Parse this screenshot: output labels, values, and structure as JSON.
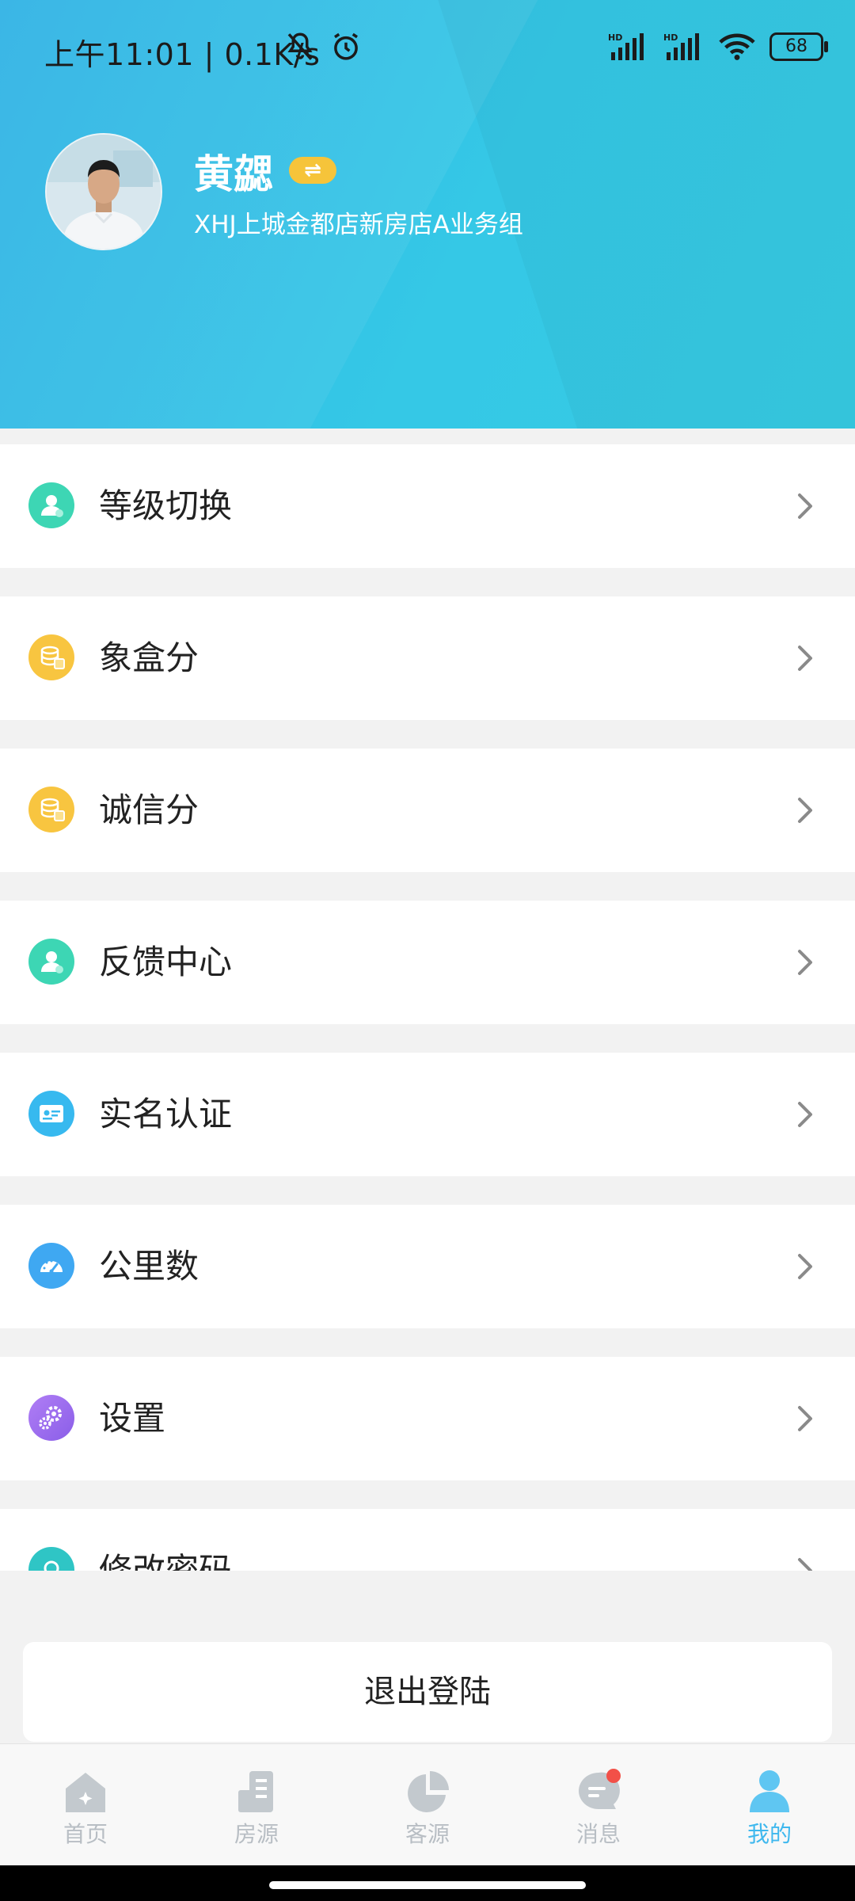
{
  "status_bar": {
    "time_speed": "上午11:01 | 0.1K/s",
    "battery": "68"
  },
  "profile": {
    "name": "黄勰",
    "switch_icon": "⇌",
    "org": "XHJ上城金都店新房店A业务组"
  },
  "menu": [
    {
      "label": "等级切换",
      "icon": "user-badge-icon",
      "color": "#3dd6b4"
    },
    {
      "label": "象盒分",
      "icon": "coins-icon",
      "color": "#f8c540"
    },
    {
      "label": "诚信分",
      "icon": "coins-icon",
      "color": "#f8c540"
    },
    {
      "label": "反馈中心",
      "icon": "user-badge-icon",
      "color": "#3dd6b4"
    },
    {
      "label": "实名认证",
      "icon": "id-card-icon",
      "color": "#37b9ef"
    },
    {
      "label": "公里数",
      "icon": "speedometer-icon",
      "color": "#3fa8f2"
    },
    {
      "label": "设置",
      "icon": "gear-icon",
      "color": "#9a6ff0"
    },
    {
      "label": "修改密码",
      "icon": "lock-icon",
      "color": "#2fc5c5"
    }
  ],
  "logout_label": "退出登陆",
  "tabs": [
    {
      "label": "首页",
      "icon": "home-icon",
      "active": false
    },
    {
      "label": "房源",
      "icon": "building-icon",
      "active": false
    },
    {
      "label": "客源",
      "icon": "pie-chart-icon",
      "active": false
    },
    {
      "label": "消息",
      "icon": "message-icon",
      "active": false
    },
    {
      "label": "我的",
      "icon": "profile-icon",
      "active": true
    }
  ],
  "colors": {
    "header_start": "#2fb2e5",
    "header_end": "#36cbe3",
    "tab_active": "#3fb8ee",
    "tab_inactive": "#b8bec4",
    "badge_yellow": "#f6c43a",
    "notification_dot": "#f25048"
  }
}
